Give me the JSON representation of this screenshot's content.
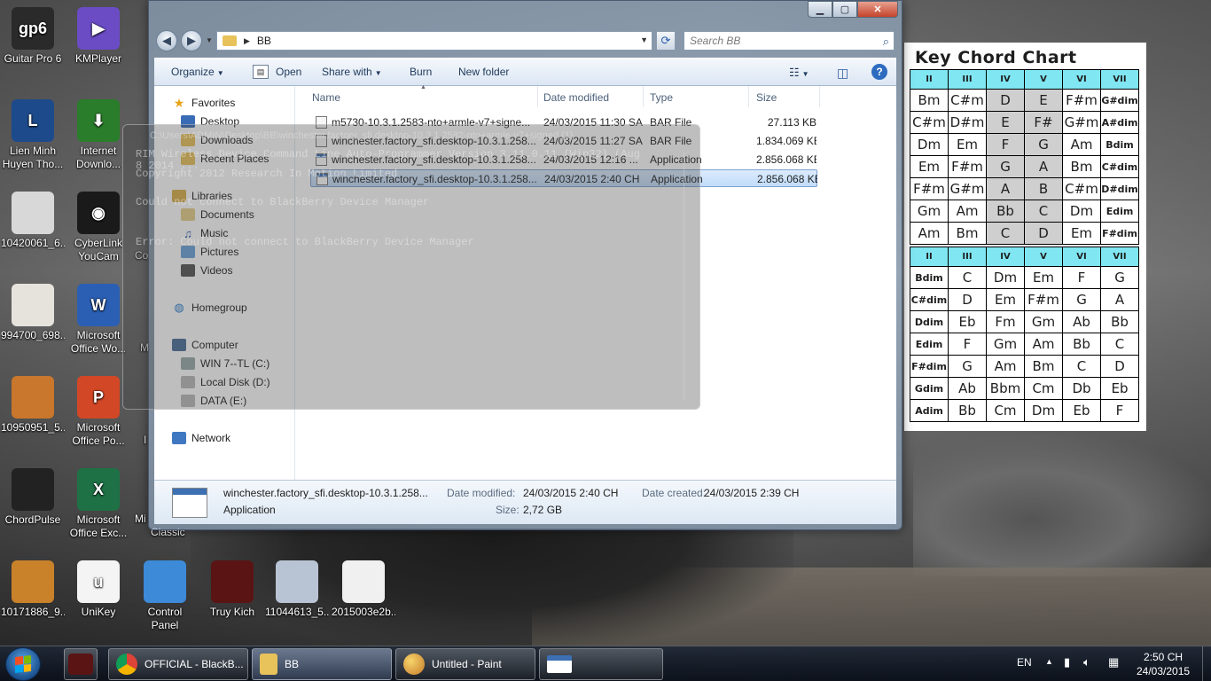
{
  "desktop_icons": [
    {
      "label": "Guitar Pro 6",
      "glyph": "gp6",
      "color": "#2a2a2a"
    },
    {
      "label": "KMPlayer",
      "glyph": "▶",
      "color": "#6b4cc4"
    },
    {
      "label": "Lien Minh Huyen Tho...",
      "glyph": "L",
      "color": "#1d4a8a"
    },
    {
      "label": "Internet Downlo...",
      "glyph": "⬇",
      "color": "#2a7d2a"
    },
    {
      "label": "10420061_6...",
      "glyph": "",
      "color": "#d8d8d8"
    },
    {
      "label": "CyberLink YouCam",
      "glyph": "◉",
      "color": "#1a1a1a"
    },
    {
      "label": "994700_698...",
      "glyph": "",
      "color": "#e6e2dc"
    },
    {
      "label": "Microsoft Office Wo...",
      "glyph": "W",
      "color": "#2b5fb4"
    },
    {
      "label": "10950951_5...",
      "glyph": "",
      "color": "#c8772c"
    },
    {
      "label": "Microsoft Office Po...",
      "glyph": "P",
      "color": "#d24726"
    },
    {
      "label": "ChordPulse",
      "glyph": "",
      "color": "#222"
    },
    {
      "label": "Microsoft Office Exc...",
      "glyph": "X",
      "color": "#1e7145"
    },
    {
      "label": "10171886_9...",
      "glyph": "",
      "color": "#c9822a"
    },
    {
      "label": "UniKey",
      "glyph": "u",
      "color": "#f4f4f4"
    },
    {
      "label": "Control Panel",
      "glyph": "",
      "color": "#3c8ad8"
    },
    {
      "label": "Truy Kich",
      "glyph": "",
      "color": "#5a1414"
    },
    {
      "label": "11044613_5...",
      "glyph": "",
      "color": "#b8c4d4"
    },
    {
      "label": "2015003e2b...",
      "glyph": "",
      "color": "#f0f0f0"
    }
  ],
  "desktop_partial": [
    "Co",
    "M",
    "I",
    "Mi",
    "Classic"
  ],
  "ghost_window": {
    "title": "C:\\Users\\ADMIN\\Desktop\\BB\\winchester.factory_sfi.desktop-10.3.1.2582-nto+armle-v7+signed (1)",
    "lines": [
      "RIM Wireless Device Command Line Auto-Programmer Version 3.11.0.11 (Win32) (Aug",
      " 8 2014 ...",
      "Copyright 2012 Research In Motion Limited",
      "Could not connect to BlackBerry Device Manager",
      "Error: Could not connect to BlackBerry Device Manager"
    ]
  },
  "explorer": {
    "address": "BB",
    "search_placeholder": "Search BB",
    "toolbar": {
      "organize": "Organize",
      "open": "Open",
      "share_with": "Share with",
      "burn": "Burn",
      "new_folder": "New folder"
    },
    "nav": {
      "favorites": "Favorites",
      "desktop": "Desktop",
      "downloads": "Downloads",
      "recent_places": "Recent Places",
      "libraries": "Libraries",
      "documents": "Documents",
      "music": "Music",
      "pictures": "Pictures",
      "videos": "Videos",
      "homegroup": "Homegroup",
      "computer": "Computer",
      "drive_c": "WIN 7--TL (C:)",
      "drive_d": "Local Disk (D:)",
      "drive_e": "DATA (E:)",
      "network": "Network"
    },
    "columns": {
      "name": "Name",
      "date": "Date modified",
      "type": "Type",
      "size": "Size"
    },
    "files": [
      {
        "name": "m5730-10.3.1.2583-nto+armle-v7+signe...",
        "date": "24/03/2015 11:30 SA",
        "type": "BAR File",
        "size": "27.113 KB",
        "kind": "bar"
      },
      {
        "name": "winchester.factory_sfi.desktop-10.3.1.258...",
        "date": "24/03/2015 11:27 SA",
        "type": "BAR File",
        "size": "1.834.069 KB",
        "kind": "bar"
      },
      {
        "name": "winchester.factory_sfi.desktop-10.3.1.258...",
        "date": "24/03/2015 12:16 ...",
        "type": "Application",
        "size": "2.856.068 KB",
        "kind": "app"
      },
      {
        "name": "winchester.factory_sfi.desktop-10.3.1.258...",
        "date": "24/03/2015 2:40 CH",
        "type": "Application",
        "size": "2.856.068 KB",
        "kind": "app"
      }
    ],
    "details": {
      "name": "winchester.factory_sfi.desktop-10.3.1.258...",
      "type": "Application",
      "modified_label": "Date modified:",
      "modified": "24/03/2015 2:40 CH",
      "created_label": "Date created:",
      "created": "24/03/2015 2:39 CH",
      "size_label": "Size:",
      "size": "2,72 GB"
    }
  },
  "chord_chart": {
    "title": "Key Chord Chart",
    "header": [
      "II",
      "III",
      "IV",
      "V",
      "VI",
      "VII"
    ],
    "top_rows": [
      [
        "Bm",
        "C#m",
        "D",
        "E",
        "F#m",
        "G#dim"
      ],
      [
        "C#m",
        "D#m",
        "E",
        "F#",
        "G#m",
        "A#dim"
      ],
      [
        "Dm",
        "Em",
        "F",
        "G",
        "Am",
        "Bdim"
      ],
      [
        "Em",
        "F#m",
        "G",
        "A",
        "Bm",
        "C#dim"
      ],
      [
        "F#m",
        "G#m",
        "A",
        "B",
        "C#m",
        "D#dim"
      ],
      [
        "Gm",
        "Am",
        "Bb",
        "C",
        "Dm",
        "Edim"
      ],
      [
        "Am",
        "Bm",
        "C",
        "D",
        "Em",
        "F#dim"
      ]
    ],
    "bottom_rows": [
      [
        "Bdim",
        "C",
        "Dm",
        "Em",
        "F",
        "G"
      ],
      [
        "C#dim",
        "D",
        "Em",
        "F#m",
        "G",
        "A"
      ],
      [
        "Ddim",
        "Eb",
        "Fm",
        "Gm",
        "Ab",
        "Bb"
      ],
      [
        "Edim",
        "F",
        "Gm",
        "Am",
        "Bb",
        "C"
      ],
      [
        "F#dim",
        "G",
        "Am",
        "Bm",
        "C",
        "D"
      ],
      [
        "Gdim",
        "Ab",
        "Bbm",
        "Cm",
        "Db",
        "Eb"
      ],
      [
        "Adim",
        "Bb",
        "Cm",
        "Dm",
        "Eb",
        "F"
      ]
    ]
  },
  "taskbar": {
    "items": [
      {
        "label": "",
        "kind": "truykich"
      },
      {
        "label": "OFFICIAL - BlackB...",
        "kind": "chrome"
      },
      {
        "label": "BB",
        "kind": "folder"
      },
      {
        "label": "Untitled - Paint",
        "kind": "paint"
      },
      {
        "label": "",
        "kind": "app"
      }
    ],
    "lang": "EN",
    "time": "2:50 CH",
    "date": "24/03/2015"
  }
}
